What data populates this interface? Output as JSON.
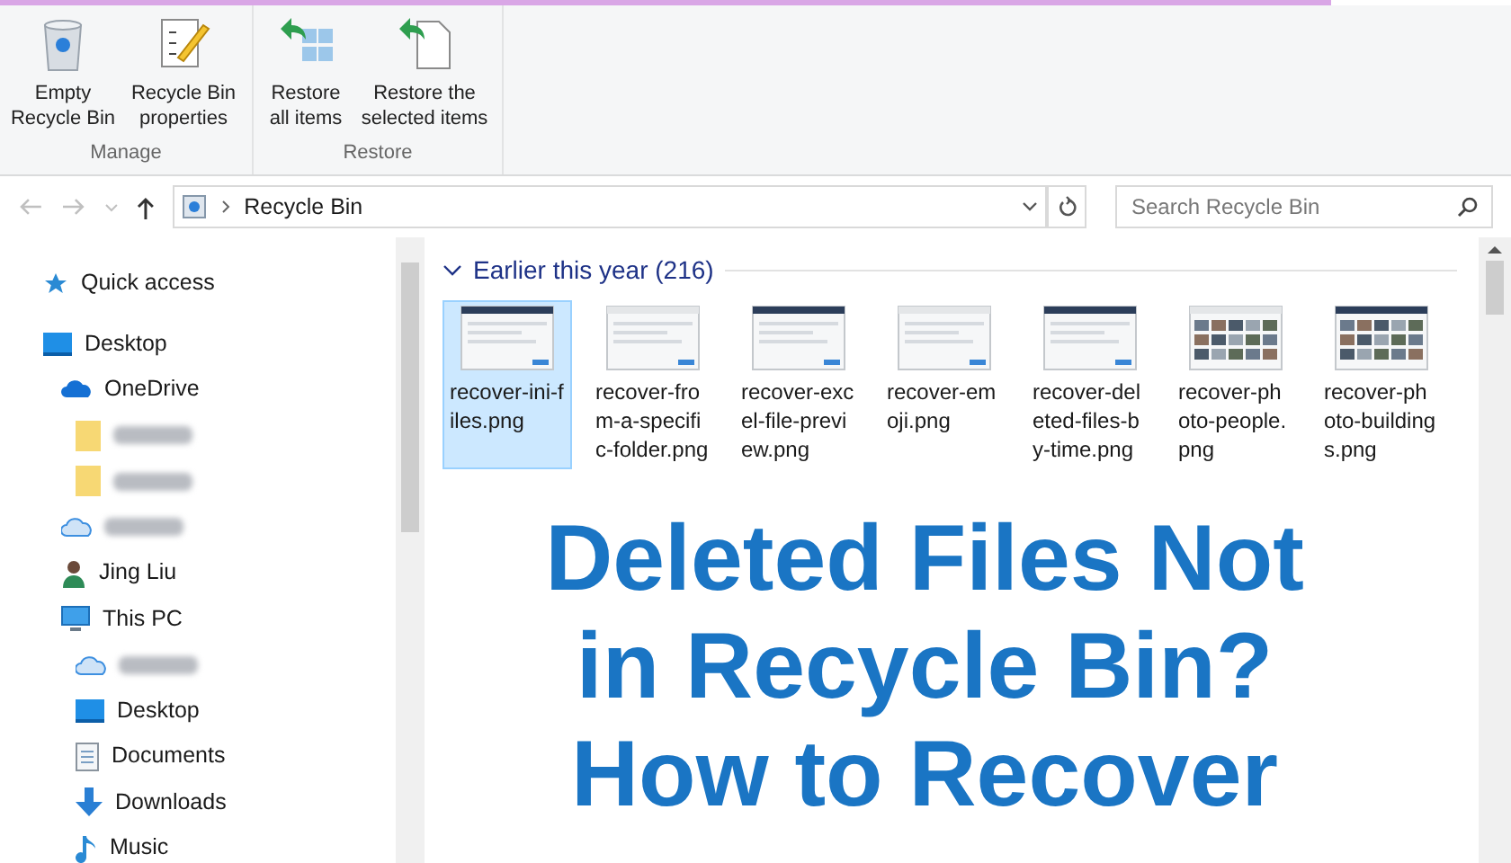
{
  "ribbon": {
    "groups": [
      {
        "label": "Manage",
        "buttons": [
          {
            "kind": "empty",
            "label": "Empty Recycle Bin"
          },
          {
            "kind": "properties",
            "label": "Recycle Bin properties"
          }
        ]
      },
      {
        "label": "Restore",
        "buttons": [
          {
            "kind": "restore_all",
            "label": "Restore all items"
          },
          {
            "kind": "restore_selected",
            "label": "Restore the selected items"
          }
        ]
      }
    ]
  },
  "address_bar": {
    "path": "Recycle Bin"
  },
  "search": {
    "placeholder": "Search Recycle Bin"
  },
  "nav_pane": {
    "items": [
      {
        "kind": "star",
        "label": "Quick access"
      },
      {
        "kind": "desktop",
        "label": "Desktop",
        "children": [
          {
            "kind": "cloud",
            "label": "OneDrive",
            "children": [
              {
                "kind": "folder"
              },
              {
                "kind": "folder"
              }
            ]
          },
          {
            "kind": "cloudalt"
          },
          {
            "kind": "user",
            "label": "Jing Liu"
          },
          {
            "kind": "pc",
            "label": "This PC",
            "children": [
              {
                "kind": "cloudalt"
              },
              {
                "kind": "desktop",
                "label": "Desktop"
              },
              {
                "kind": "document",
                "label": "Documents"
              },
              {
                "kind": "download",
                "label": "Downloads"
              },
              {
                "kind": "music",
                "label": "Music"
              }
            ]
          }
        ]
      }
    ]
  },
  "group": {
    "title": "Earlier this year (216)",
    "expanded": true
  },
  "files": [
    {
      "name": "recover-ini-files.png",
      "selected": true
    },
    {
      "name": "recover-from-a-specific-folder.png",
      "selected": false
    },
    {
      "name": "recover-excel-file-preview.png",
      "selected": false
    },
    {
      "name": "recover-emoji.png",
      "selected": false
    },
    {
      "name": "recover-deleted-files-by-time.png",
      "selected": false
    },
    {
      "name": "recover-photo-people.png",
      "selected": false
    },
    {
      "name": "recover-photo-buildings.png",
      "selected": false
    }
  ],
  "overlay_title": [
    "Deleted Files Not",
    "in Recycle Bin?",
    "How to Recover"
  ]
}
